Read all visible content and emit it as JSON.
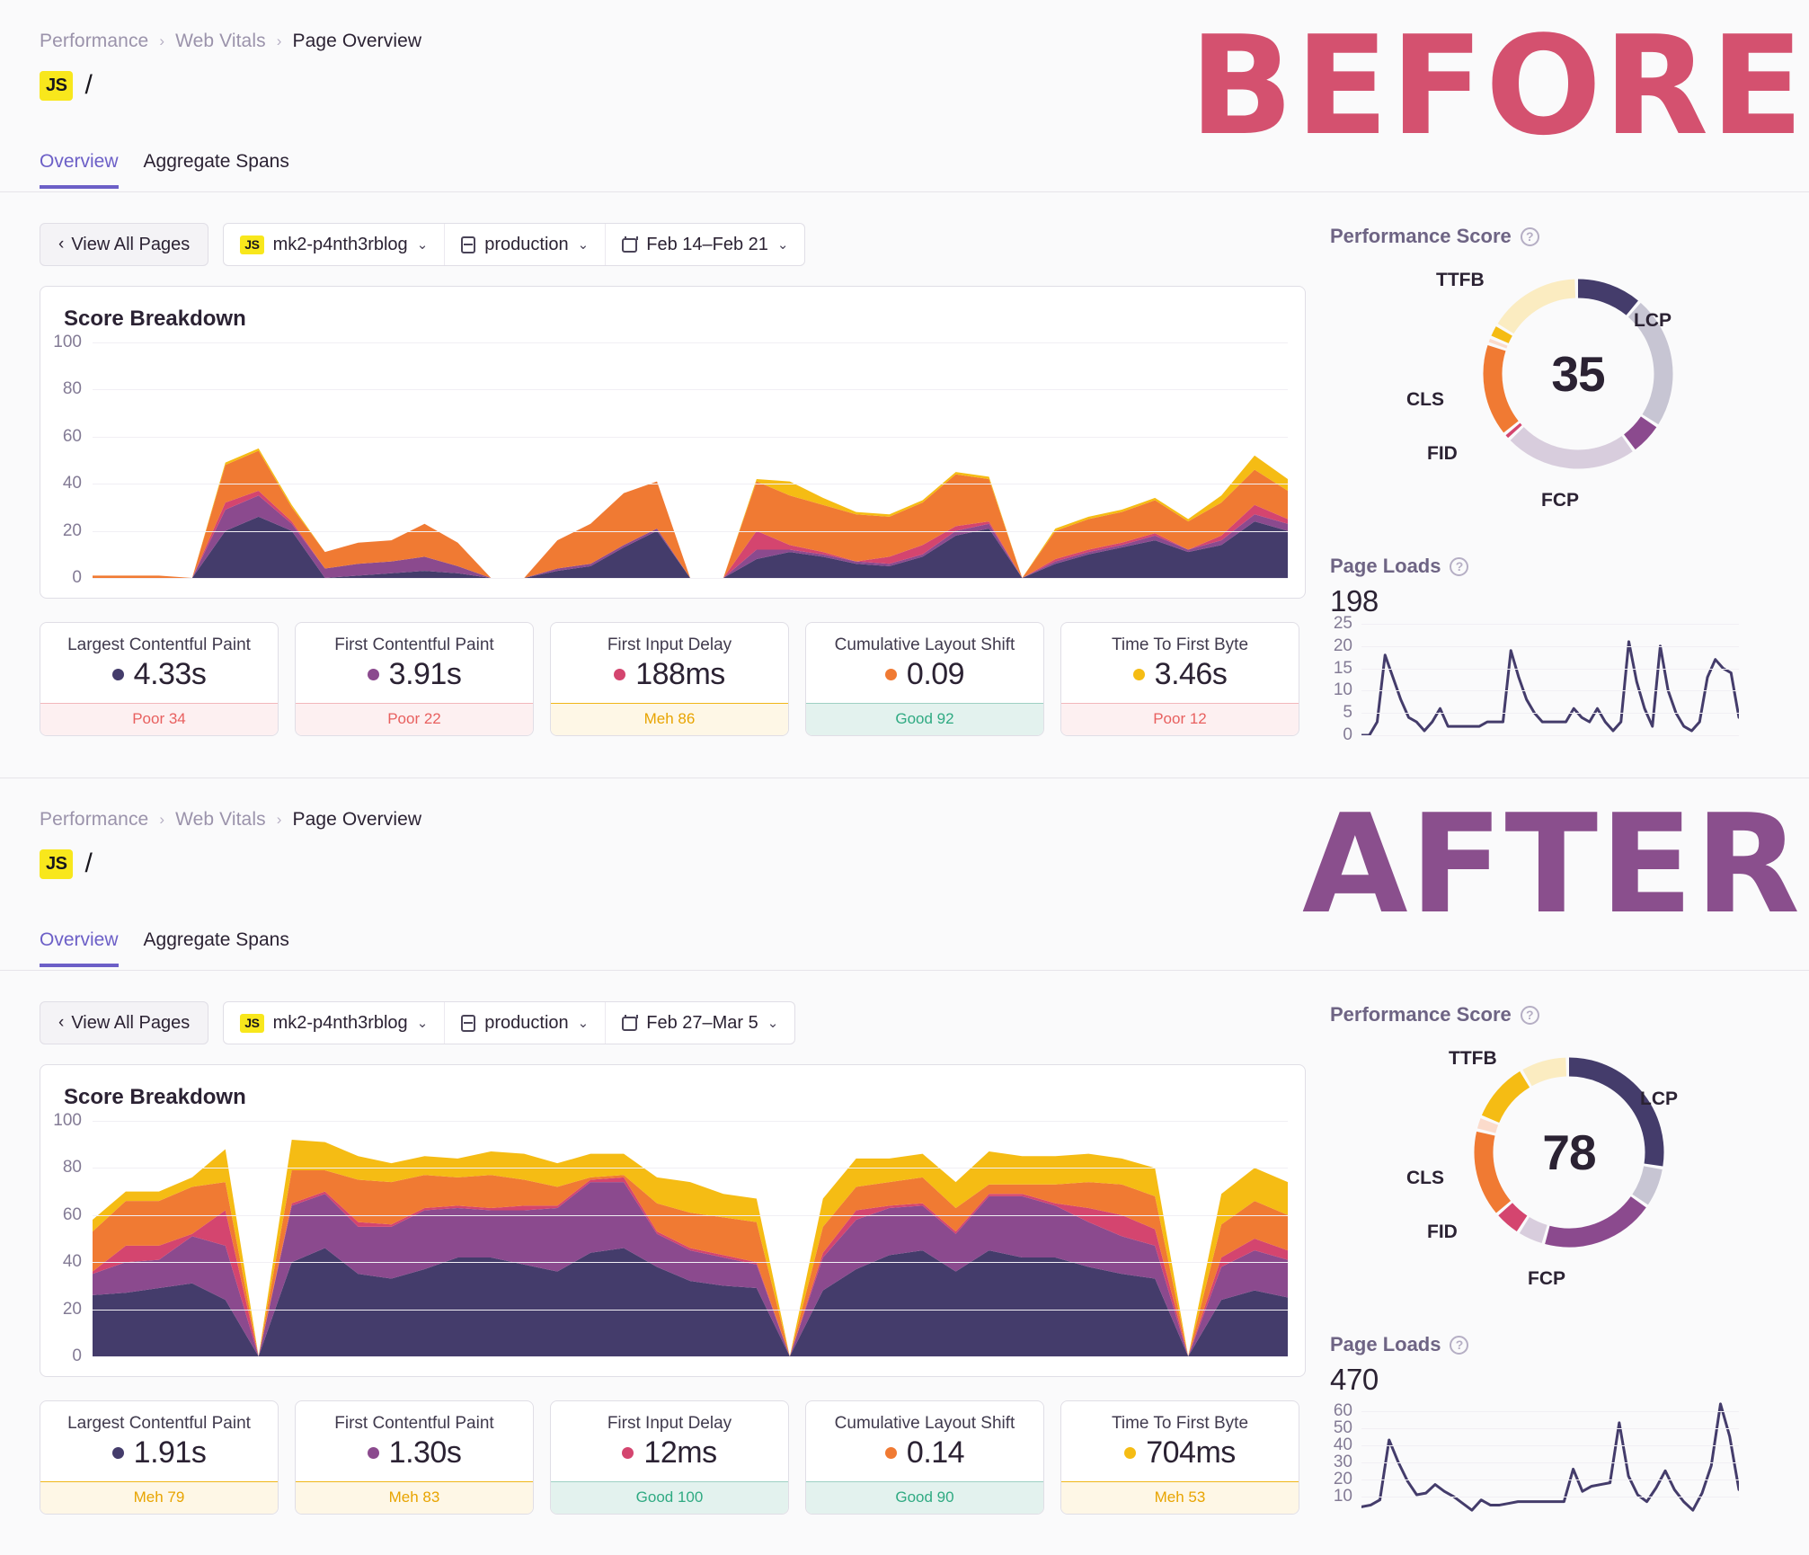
{
  "colors": {
    "lcp": "#443c6b",
    "fcp": "#8b4a8e",
    "fid": "#d4456f",
    "cls": "#f07a33",
    "ttfb": "#f5bc14",
    "lcp_light": "#c7c5d3",
    "fcp_light": "#d8cddd",
    "fid_light": "#fbd6e0",
    "cls_light": "#fbdbcb",
    "ttfb_light": "#fbecc1",
    "accent": "#6c5fc7",
    "yellow_badge": "#f8e71c",
    "poor": "#e8605f",
    "meh": "#e8a400",
    "good": "#2faa82",
    "before_fill": "#d4516f",
    "after_fill": "#8a4f8d",
    "overlay_stroke": "#4b4b77"
  },
  "overlay": {
    "before_label": "BEFORE",
    "after_label": "AFTER"
  },
  "before": {
    "breadcrumb": [
      "Performance",
      "Web Vitals",
      "Page Overview"
    ],
    "breadcrumb_separator": "›",
    "badge": "JS",
    "page_path": "/",
    "tabs": [
      {
        "label": "Overview",
        "active": true
      },
      {
        "label": "Aggregate Spans",
        "active": false
      }
    ],
    "toolbar": {
      "view_all_label": "View All Pages",
      "back_chevron": "‹",
      "project_badge": "JS",
      "project": "mk2-p4nth3rblog",
      "environment": "production",
      "date_range": "Feb 14–Feb 21",
      "chevron": "⌄"
    },
    "score_card": {
      "title": "Score Breakdown"
    },
    "metrics": [
      {
        "name": "Largest Contentful Paint",
        "value": "4.33s",
        "dot": "lcp",
        "status": "Poor 34",
        "status_type": "poor"
      },
      {
        "name": "First Contentful Paint",
        "value": "3.91s",
        "dot": "fcp",
        "status": "Poor 22",
        "status_type": "poor"
      },
      {
        "name": "First Input Delay",
        "value": "188ms",
        "dot": "fid",
        "status": "Meh 86",
        "status_type": "meh"
      },
      {
        "name": "Cumulative Layout Shift",
        "value": "0.09",
        "dot": "cls",
        "status": "Good 92",
        "status_type": "good"
      },
      {
        "name": "Time To First Byte",
        "value": "3.46s",
        "dot": "ttfb",
        "status": "Poor 12",
        "status_type": "poor"
      }
    ],
    "performance_score": {
      "title": "Performance Score",
      "help_glyph": "?",
      "score": "35",
      "labels": [
        "LCP",
        "FCP",
        "FID",
        "CLS",
        "TTFB"
      ]
    },
    "page_loads": {
      "title": "Page Loads",
      "help_glyph": "?",
      "value": "198"
    }
  },
  "after": {
    "breadcrumb": [
      "Performance",
      "Web Vitals",
      "Page Overview"
    ],
    "breadcrumb_separator": "›",
    "badge": "JS",
    "page_path": "/",
    "tabs": [
      {
        "label": "Overview",
        "active": true
      },
      {
        "label": "Aggregate Spans",
        "active": false
      }
    ],
    "toolbar": {
      "view_all_label": "View All Pages",
      "back_chevron": "‹",
      "project_badge": "JS",
      "project": "mk2-p4nth3rblog",
      "environment": "production",
      "date_range": "Feb 27–Mar 5",
      "chevron": "⌄"
    },
    "score_card": {
      "title": "Score Breakdown"
    },
    "metrics": [
      {
        "name": "Largest Contentful Paint",
        "value": "1.91s",
        "dot": "lcp",
        "status": "Meh 79",
        "status_type": "meh"
      },
      {
        "name": "First Contentful Paint",
        "value": "1.30s",
        "dot": "fcp",
        "status": "Meh 83",
        "status_type": "meh"
      },
      {
        "name": "First Input Delay",
        "value": "12ms",
        "dot": "fid",
        "status": "Good 100",
        "status_type": "good"
      },
      {
        "name": "Cumulative Layout Shift",
        "value": "0.14",
        "dot": "cls",
        "status": "Good 90",
        "status_type": "good"
      },
      {
        "name": "Time To First Byte",
        "value": "704ms",
        "dot": "ttfb",
        "status": "Meh 53",
        "status_type": "meh"
      }
    ],
    "performance_score": {
      "title": "Performance Score",
      "help_glyph": "?",
      "score": "78",
      "labels": [
        "LCP",
        "FCP",
        "FID",
        "CLS",
        "TTFB"
      ]
    },
    "page_loads": {
      "title": "Page Loads",
      "help_glyph": "?",
      "value": "470"
    }
  },
  "chart_data": [
    {
      "id": "before_score_breakdown",
      "type": "area",
      "stacked": true,
      "title": "Score Breakdown",
      "xlabel": "",
      "ylabel": "",
      "ylim": [
        0,
        100
      ],
      "yticks": [
        0,
        20,
        40,
        60,
        80,
        100
      ],
      "grid": true,
      "legend": "none",
      "series": [
        {
          "name": "LCP",
          "color": "#443c6b",
          "values": [
            0,
            0,
            0,
            0,
            20,
            26,
            20,
            0,
            1,
            2,
            3,
            2,
            0,
            0,
            3,
            5,
            13,
            20,
            0,
            0,
            8,
            11,
            9,
            6,
            5,
            9,
            18,
            21,
            0,
            6,
            10,
            13,
            16,
            11,
            14,
            24,
            20
          ]
        },
        {
          "name": "FCP",
          "color": "#8b4a8e",
          "values": [
            0,
            0,
            0,
            0,
            9,
            9,
            3,
            4,
            5,
            5,
            6,
            3,
            0,
            0,
            1,
            1,
            1,
            1,
            0,
            0,
            4,
            1,
            1,
            1,
            1,
            1,
            2,
            2,
            0,
            1,
            1,
            1,
            2,
            1,
            2,
            3,
            3
          ]
        },
        {
          "name": "FID",
          "color": "#d4456f",
          "values": [
            0,
            0,
            0,
            0,
            3,
            2,
            1,
            0,
            0,
            0,
            0,
            0,
            0,
            0,
            0,
            0,
            0,
            0,
            0,
            0,
            8,
            2,
            1,
            0,
            3,
            4,
            2,
            1,
            0,
            1,
            1,
            1,
            1,
            0,
            2,
            4,
            2
          ]
        },
        {
          "name": "CLS",
          "color": "#f07a33",
          "values": [
            1,
            1,
            1,
            0,
            16,
            17,
            6,
            7,
            9,
            9,
            14,
            10,
            0,
            0,
            12,
            17,
            22,
            20,
            0,
            0,
            21,
            21,
            20,
            20,
            17,
            18,
            22,
            18,
            0,
            12,
            13,
            13,
            14,
            12,
            14,
            15,
            12
          ]
        },
        {
          "name": "TTFB",
          "color": "#f5bc14",
          "values": [
            0,
            0,
            0,
            0,
            1,
            1,
            1,
            0,
            0,
            0,
            0,
            0,
            0,
            0,
            0,
            0,
            0,
            0,
            0,
            0,
            1,
            6,
            3,
            1,
            1,
            1,
            1,
            1,
            0,
            1,
            1,
            1,
            1,
            1,
            3,
            6,
            5
          ]
        }
      ]
    },
    {
      "id": "before_performance_score_donut",
      "type": "pie",
      "title": "Performance Score",
      "center_value": "35",
      "segments": [
        {
          "name": "LCP",
          "filled": 10,
          "remaining": 20,
          "color": "#443c6b",
          "light": "#c7c5d3"
        },
        {
          "name": "FCP",
          "filled": 5,
          "remaining": 20,
          "color": "#8b4a8e",
          "light": "#d8cddd"
        },
        {
          "name": "FID",
          "filled": 1,
          "remaining": 0,
          "color": "#d4456f",
          "light": "#fbd6e0"
        },
        {
          "name": "CLS",
          "filled": 14,
          "remaining": 1,
          "color": "#f07a33",
          "light": "#fbdbcb"
        },
        {
          "name": "TTFB",
          "filled": 2,
          "remaining": 14,
          "color": "#f5bc14",
          "light": "#fbecc1"
        }
      ]
    },
    {
      "id": "before_page_loads",
      "type": "line",
      "title": "Page Loads",
      "total": "198",
      "ylim": [
        0,
        25
      ],
      "yticks": [
        0,
        5,
        10,
        15,
        20,
        25
      ],
      "color": "#443c6b",
      "values": [
        0,
        0,
        3,
        18,
        13,
        8,
        4,
        3,
        1,
        3,
        6,
        2,
        2,
        2,
        2,
        2,
        3,
        3,
        3,
        19,
        13,
        8,
        5,
        3,
        3,
        3,
        3,
        6,
        4,
        3,
        6,
        3,
        1,
        3,
        21,
        12,
        6,
        2,
        20,
        10,
        5,
        2,
        1,
        3,
        13,
        17,
        15,
        14,
        4
      ]
    },
    {
      "id": "after_score_breakdown",
      "type": "area",
      "stacked": true,
      "title": "Score Breakdown",
      "xlabel": "",
      "ylabel": "",
      "ylim": [
        0,
        100
      ],
      "yticks": [
        0,
        20,
        40,
        60,
        80,
        100
      ],
      "grid": true,
      "legend": "none",
      "series": [
        {
          "name": "LCP",
          "color": "#443c6b",
          "values": [
            26,
            27,
            29,
            31,
            24,
            0,
            40,
            46,
            35,
            33,
            37,
            42,
            42,
            39,
            36,
            44,
            46,
            38,
            32,
            30,
            29,
            0,
            28,
            37,
            43,
            45,
            36,
            45,
            42,
            42,
            38,
            35,
            33,
            0,
            24,
            28,
            25
          ]
        },
        {
          "name": "FCP",
          "color": "#8b4a8e",
          "values": [
            9,
            13,
            12,
            20,
            23,
            0,
            24,
            23,
            20,
            22,
            25,
            21,
            20,
            23,
            27,
            30,
            28,
            14,
            13,
            12,
            10,
            0,
            14,
            21,
            20,
            19,
            16,
            23,
            26,
            22,
            19,
            16,
            14,
            0,
            14,
            17,
            16
          ]
        },
        {
          "name": "FID",
          "color": "#d4456f",
          "values": [
            1,
            7,
            6,
            1,
            15,
            0,
            1,
            1,
            2,
            1,
            1,
            1,
            1,
            2,
            1,
            1,
            2,
            1,
            1,
            1,
            1,
            0,
            2,
            4,
            1,
            1,
            1,
            1,
            1,
            1,
            6,
            9,
            7,
            0,
            4,
            5,
            4
          ]
        },
        {
          "name": "CLS",
          "color": "#f07a33",
          "values": [
            17,
            19,
            19,
            20,
            12,
            0,
            14,
            9,
            18,
            18,
            14,
            12,
            14,
            11,
            8,
            1,
            1,
            12,
            15,
            16,
            17,
            0,
            11,
            10,
            10,
            11,
            10,
            4,
            4,
            8,
            11,
            13,
            14,
            0,
            14,
            16,
            15
          ]
        },
        {
          "name": "TTFB",
          "color": "#f5bc14",
          "values": [
            5,
            4,
            4,
            4,
            14,
            0,
            13,
            12,
            10,
            8,
            8,
            8,
            10,
            11,
            10,
            10,
            9,
            11,
            13,
            10,
            10,
            0,
            12,
            12,
            10,
            10,
            11,
            14,
            12,
            12,
            12,
            11,
            12,
            0,
            13,
            14,
            14
          ]
        }
      ]
    },
    {
      "id": "after_performance_score_donut",
      "type": "pie",
      "title": "Performance Score",
      "center_value": "78",
      "segments": [
        {
          "name": "LCP",
          "filled": 24,
          "remaining": 6,
          "color": "#443c6b",
          "light": "#c7c5d3"
        },
        {
          "name": "FCP",
          "filled": 17,
          "remaining": 4,
          "color": "#8b4a8e",
          "light": "#d8cddd"
        },
        {
          "name": "FID",
          "filled": 4,
          "remaining": 0,
          "color": "#d4456f",
          "light": "#fbd6e0"
        },
        {
          "name": "CLS",
          "filled": 13,
          "remaining": 2,
          "color": "#f07a33",
          "light": "#fbdbcb"
        },
        {
          "name": "TTFB",
          "filled": 9,
          "remaining": 7,
          "color": "#f5bc14",
          "light": "#fbecc1"
        }
      ]
    },
    {
      "id": "after_page_loads",
      "type": "line",
      "title": "Page Loads",
      "total": "470",
      "ylim": [
        0,
        65
      ],
      "yticks": [
        10,
        20,
        30,
        40,
        50,
        60
      ],
      "color": "#443c6b",
      "values": [
        4,
        5,
        8,
        43,
        30,
        19,
        11,
        12,
        17,
        13,
        10,
        6,
        2,
        8,
        5,
        5,
        6,
        7,
        7,
        7,
        7,
        7,
        7,
        26,
        13,
        16,
        17,
        18,
        53,
        22,
        11,
        7,
        15,
        25,
        14,
        7,
        2,
        12,
        28,
        64,
        45,
        14
      ]
    }
  ]
}
